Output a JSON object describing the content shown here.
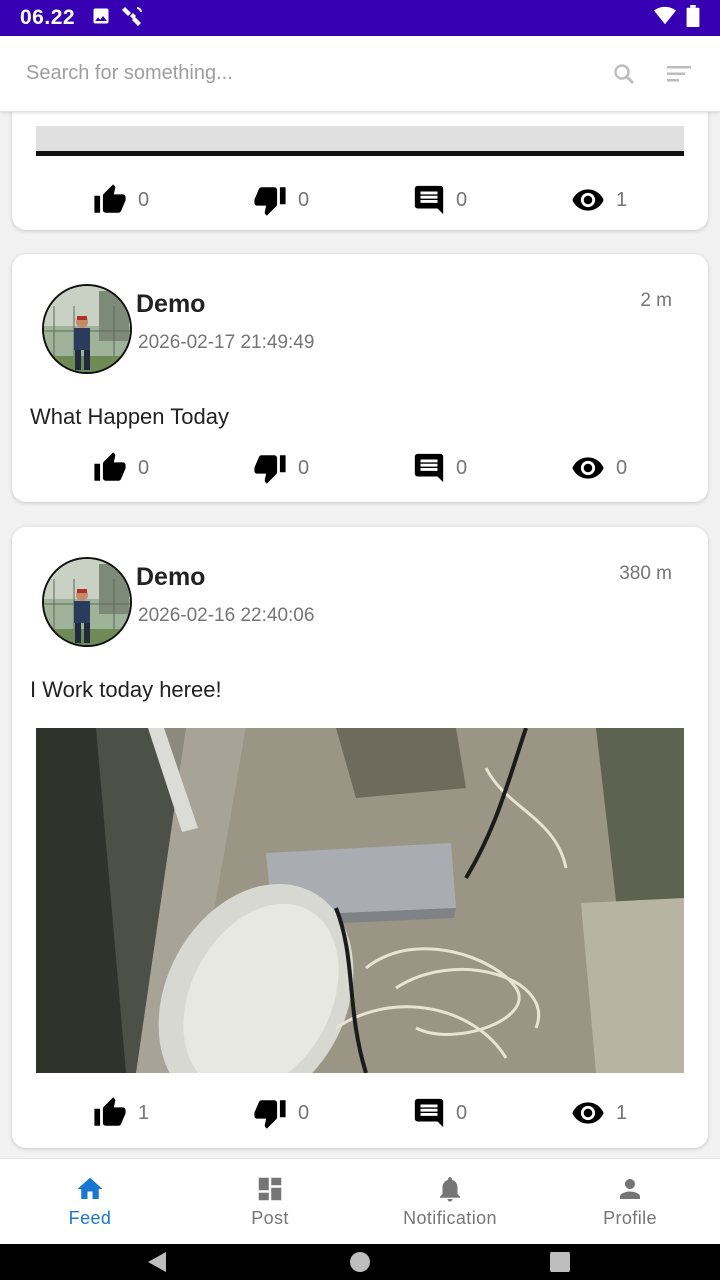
{
  "status_bar": {
    "time": "06.22"
  },
  "search": {
    "placeholder": "Search for something..."
  },
  "posts": [
    {
      "actions": {
        "likes": "0",
        "dislikes": "0",
        "comments": "0",
        "views": "1"
      }
    },
    {
      "username": "Demo",
      "timestamp": "2026-02-17 21:49:49",
      "ago": "2 m",
      "text": "What Happen Today",
      "actions": {
        "likes": "0",
        "dislikes": "0",
        "comments": "0",
        "views": "0"
      }
    },
    {
      "username": "Demo",
      "timestamp": "2026-02-16 22:40:06",
      "ago": "380 m",
      "text": "I Work today hereе!",
      "actions": {
        "likes": "1",
        "dislikes": "0",
        "comments": "0",
        "views": "1"
      }
    }
  ],
  "bottom_nav": [
    {
      "label": "Feed",
      "icon": "home-icon",
      "active": true
    },
    {
      "label": "Post",
      "icon": "dashboard-icon",
      "active": false
    },
    {
      "label": "Notification",
      "icon": "bell-icon",
      "active": false
    },
    {
      "label": "Profile",
      "icon": "person-icon",
      "active": false
    }
  ],
  "colors": {
    "status_bar": "#3700b3",
    "accent": "#1976d2",
    "muted": "#757575"
  }
}
